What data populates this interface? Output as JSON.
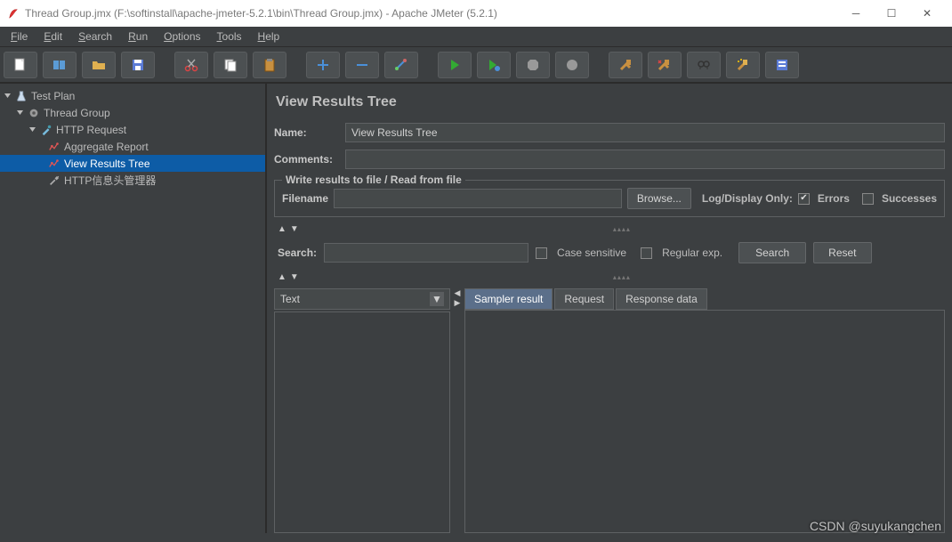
{
  "window": {
    "title": "Thread Group.jmx (F:\\softinstall\\apache-jmeter-5.2.1\\bin\\Thread Group.jmx) - Apache JMeter (5.2.1)"
  },
  "menubar": {
    "file": "File",
    "edit": "Edit",
    "search": "Search",
    "run": "Run",
    "options": "Options",
    "tools": "Tools",
    "help": "Help"
  },
  "tree": {
    "nodes": {
      "testplan": "Test Plan",
      "threadgroup": "Thread Group",
      "httprequest": "HTTP Request",
      "aggregate": "Aggregate Report",
      "viewresults": "View Results Tree",
      "httpheader": "HTTP信息头管理器"
    }
  },
  "panel": {
    "title": "View Results Tree",
    "name_label": "Name:",
    "name_value": "View Results Tree",
    "comments_label": "Comments:",
    "comments_value": "",
    "writeresults": {
      "legend": "Write results to file / Read from file",
      "filename_label": "Filename",
      "filename_value": "",
      "browse": "Browse...",
      "logdisplay": "Log/Display Only:",
      "errors": "Errors",
      "successes": "Successes",
      "errors_checked": true,
      "successes_checked": false
    },
    "search": {
      "label": "Search:",
      "value": "",
      "case_sensitive": "Case sensitive",
      "regex": "Regular exp.",
      "search_btn": "Search",
      "reset_btn": "Reset"
    },
    "renderer": {
      "selected": "Text"
    },
    "tabs": {
      "sampler": "Sampler result",
      "request": "Request",
      "response": "Response data"
    }
  },
  "watermark": "CSDN @suyukangchen"
}
